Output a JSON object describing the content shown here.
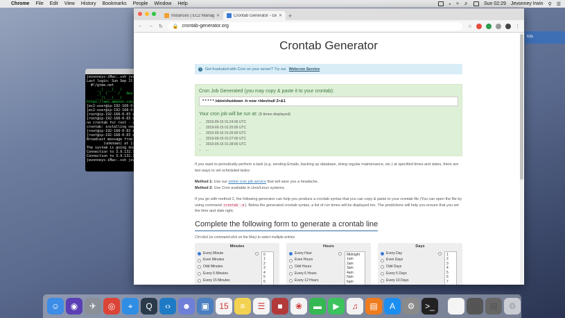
{
  "menubar": {
    "apple": "",
    "items": [
      "Chrome",
      "File",
      "Edit",
      "View",
      "History",
      "Bookmarks",
      "People",
      "Window",
      "Help"
    ],
    "clock": "Sun 02:29",
    "user": "Jevonney Irwin"
  },
  "desktop": {
    "side_label": "lcts"
  },
  "terminal": {
    "title": "jevonney — ssh",
    "lines": [
      {
        "t": "jevonneys-iMac:.ssh jevo",
        "c": ""
      },
      {
        "t": "Last login: Sun Sep 15 0",
        "c": ""
      },
      {
        "t": "  #!/gtme.net",
        "c": ""
      },
      {
        "t": "",
        "c": ""
      },
      {
        "t": "     __|  __|_  )",
        "c": "g"
      },
      {
        "t": "     _|  (     /   Ama",
        "c": "g"
      },
      {
        "t": "    ___|\\___|___|",
        "c": "g"
      },
      {
        "t": "",
        "c": ""
      },
      {
        "t": "https://aws.amazon.com/a",
        "c": "g"
      },
      {
        "t": "[ec2-user@ip-192-168-0-",
        "c": ""
      },
      {
        "t": "[ec2-user@ip-192-168-0-",
        "c": ""
      },
      {
        "t": "[root@ip-192-168-0-83 ec",
        "c": ""
      },
      {
        "t": "[root@ip-192-168-0-83 ec",
        "c": ""
      },
      {
        "t": "no crontab for root - us",
        "c": ""
      },
      {
        "t": "crontab: installing new",
        "c": ""
      },
      {
        "t": "[root@ip-192-168-0-83 ec",
        "c": ""
      },
      {
        "t": "[root@ip-192-168-0-83 ec",
        "c": ""
      },
      {
        "t": "Broadcast message from r",
        "c": ""
      },
      {
        "t": "        (unknown) at 1:3",
        "c": ""
      },
      {
        "t": "",
        "c": ""
      },
      {
        "t": "The system is going down",
        "c": ""
      },
      {
        "t": "Connection to 3.9.132.13",
        "c": ""
      },
      {
        "t": "Connection to 3.9.132.13",
        "c": ""
      },
      {
        "t": "jevonneys-iMac:.ssh jevo",
        "c": ""
      }
    ]
  },
  "browser": {
    "tabs": [
      {
        "label": "Instances | EC2 Management C",
        "active": false,
        "fav_color": "#f0a030"
      },
      {
        "label": "Crontab Generator - Generate",
        "active": true,
        "fav_color": "#3a7bd5"
      }
    ],
    "newtab": "+",
    "url": "crontab-generator.org"
  },
  "page": {
    "title": "Crontab Generator",
    "info_text": "Get frustrated with Cron on your server? Try our",
    "info_link": "Webcron Service",
    "generated_label": "Cron Job Generated (you may copy & paste it to your crontab):",
    "cron_line": "* * * * * /sbin/shutdown -h now >/dev/null 2>&1",
    "run_label": "Your cron job will be run at:",
    "run_note": "(5 times displayed)",
    "runs": [
      "2019-09-15 01:24:00 UTC",
      "2019-09-15 01:25:00 UTC",
      "2019-09-15 01:26:00 UTC",
      "2019-09-15 01:27:00 UTC",
      "2019-09-15 01:28:00 UTC",
      "..."
    ],
    "para1": "If you want to periodically perform a task (e.g. sending Emails, backing up database, doing regular maintenance, etc.) at specified times and dates, there are two ways to set scheduled tasks:",
    "m1_label": "Method 1:",
    "m1_pre": "Use our",
    "m1_link": "online cron job service",
    "m1_post": "that will save you a headache.",
    "m2_label": "Method 2:",
    "m2_text": "Use Cron available in Unix/Linux systems.",
    "para2_a": "If you go with method 2, the following generator can help you produce a crontab syntax that you can copy & paste to your crontab file (You can open the file by using command",
    "para2_code": "crontab -e",
    "para2_b": "). Below the generated crontab syntax, a list of run times will be displayed too. The predictions will help you ensure that you set the time and date right.",
    "form_title": "Complete the following form to generate a crontab line",
    "form_note": "Ctrl-click (or command-click on the Mac) to select multiple entries",
    "panels": [
      {
        "title": "Minutes",
        "options": [
          "Every Minute",
          "Even Minutes",
          "Odd Minutes",
          "Every 5 Minutes",
          "Every 15 Minutes"
        ],
        "list": [
          "0",
          "1",
          "2",
          "3",
          "4",
          "5",
          "6"
        ]
      },
      {
        "title": "Hours",
        "options": [
          "Every Hour",
          "Even Hours",
          "Odd Hours",
          "Every 6 Hours",
          "Every 12 Hours"
        ],
        "list": [
          "Midnight",
          "1am",
          "2am",
          "3am",
          "4am",
          "5am",
          "6am"
        ]
      },
      {
        "title": "Days",
        "options": [
          "Every Day",
          "Even Days",
          "Odd Days",
          "Every 5 Days",
          "Every 10 Days"
        ],
        "list": [
          "1",
          "2",
          "3",
          "4",
          "5",
          "6",
          "7"
        ]
      }
    ]
  },
  "dock": {
    "apps": [
      {
        "name": "finder-icon",
        "color": "#3d8ce8",
        "glyph": "☺"
      },
      {
        "name": "siri-icon",
        "color": "#5b3fb5",
        "glyph": "◉"
      },
      {
        "name": "launchpad-icon",
        "color": "#8a8f98",
        "glyph": "✈"
      },
      {
        "name": "chrome-icon",
        "color": "#db4437",
        "glyph": "◎"
      },
      {
        "name": "safari-icon",
        "color": "#2f8de4",
        "glyph": "⌖"
      },
      {
        "name": "quicktime-icon",
        "color": "#2a3a4a",
        "glyph": "Q"
      },
      {
        "name": "vscode-icon",
        "color": "#1f7ac6",
        "glyph": "‹›"
      },
      {
        "name": "discord-icon",
        "color": "#6f7fd8",
        "glyph": "☻"
      },
      {
        "name": "preview-icon",
        "color": "#4a7fc0",
        "glyph": "▣"
      },
      {
        "name": "calendar-icon",
        "color": "#f4f4f4",
        "glyph": "15"
      },
      {
        "name": "notes-icon",
        "color": "#f2d250",
        "glyph": "≡"
      },
      {
        "name": "reminders-icon",
        "color": "#f4f4f4",
        "glyph": "☰"
      },
      {
        "name": "photo-booth-icon",
        "color": "#b23a3a",
        "glyph": "■"
      },
      {
        "name": "photos-icon",
        "color": "#f4f4f4",
        "glyph": "❀"
      },
      {
        "name": "messages-icon",
        "color": "#35b852",
        "glyph": "▬"
      },
      {
        "name": "facetime-icon",
        "color": "#3cc35e",
        "glyph": "▶"
      },
      {
        "name": "music-icon",
        "color": "#f2f2f2",
        "glyph": "♫"
      },
      {
        "name": "books-icon",
        "color": "#ef7c1e",
        "glyph": "▤"
      },
      {
        "name": "app-store-icon",
        "color": "#1c8ef0",
        "glyph": "A"
      },
      {
        "name": "system-preferences-icon",
        "color": "#8a8a8a",
        "glyph": "⚙"
      },
      {
        "name": "terminal-icon",
        "color": "#222",
        "glyph": ">_"
      }
    ],
    "stack": [
      {
        "name": "document-icon",
        "color": "#f4f4f4",
        "glyph": ""
      },
      {
        "name": "downloads-stack-icon",
        "color": "#555",
        "glyph": "▤"
      },
      {
        "name": "screenshots-stack-icon",
        "color": "#666",
        "glyph": "▤"
      },
      {
        "name": "trash-icon",
        "color": "#c9ccd2",
        "glyph": "♲"
      }
    ]
  }
}
